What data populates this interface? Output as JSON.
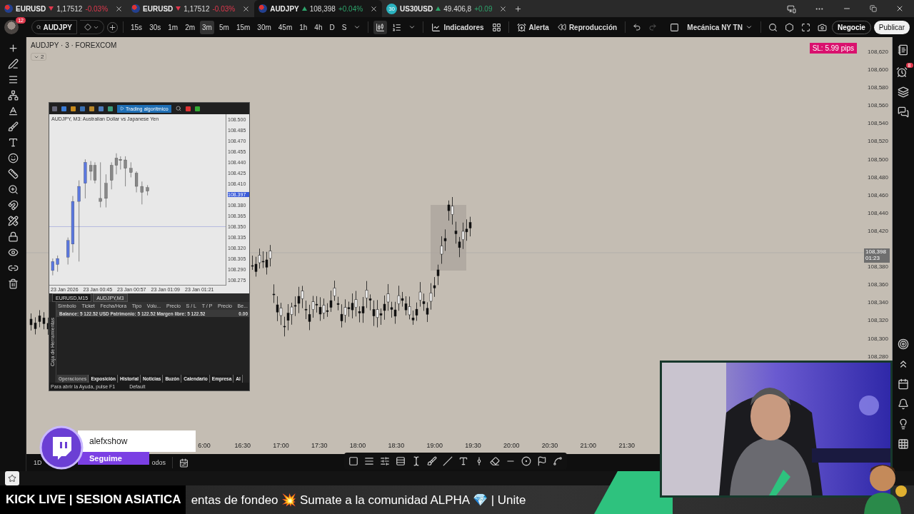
{
  "browser_tabs": [
    {
      "symbol": "EURUSD",
      "rising": false,
      "price": "1,17512",
      "change": "-0.03%",
      "selected": false
    },
    {
      "symbol": "EURUSD",
      "rising": false,
      "price": "1,17512",
      "change": "-0.03%",
      "selected": false
    },
    {
      "symbol": "AUDJPY",
      "rising": true,
      "price": "108,398",
      "change": "+0.04%",
      "selected": true
    },
    {
      "symbol": "US30USD",
      "rising": true,
      "price": "49.406,8",
      "change": "+0.09",
      "selected": false,
      "badge": "30"
    }
  ],
  "toolbar": {
    "avatar_badge": "12",
    "symbol": "AUDJPY",
    "intervals": [
      {
        "label": "15s",
        "selected": false
      },
      {
        "label": "30s",
        "selected": false
      },
      {
        "label": "1m",
        "selected": false
      },
      {
        "label": "2m",
        "selected": false
      },
      {
        "label": "3m",
        "selected": true
      },
      {
        "label": "5m",
        "selected": false
      },
      {
        "label": "15m",
        "selected": false
      },
      {
        "label": "30m",
        "selected": false
      },
      {
        "label": "45m",
        "selected": false
      },
      {
        "label": "1h",
        "selected": false
      },
      {
        "label": "4h",
        "selected": false
      },
      {
        "label": "D",
        "selected": false
      },
      {
        "label": "S",
        "selected": false
      }
    ],
    "indicators": "Indicadores",
    "alert": "Alerta",
    "replay": "Reproducción",
    "layout": "Mecánica NY TN",
    "trade": "Negocie",
    "publish": "Publicar"
  },
  "chart": {
    "title": "AUDJPY · 3 · FOREXCOM",
    "collapse_count": "2",
    "sl_badge": "SL: 5.99 pips",
    "price_scale": [
      "108,620",
      "108,600",
      "108,580",
      "108,560",
      "108,540",
      "108,520",
      "108,500",
      "108,480",
      "108,460",
      "108,440",
      "108,420",
      "108,380",
      "108,360",
      "108,340",
      "108,320",
      "108,300",
      "108,280"
    ],
    "last_price": "108,398",
    "countdown": "01:23",
    "time_scale": [
      "6:00",
      "16:30",
      "17:00",
      "17:30",
      "18:00",
      "18:30",
      "19:00",
      "19:30",
      "20:00",
      "20:30",
      "21:00",
      "21:30"
    ]
  },
  "mt5_window": {
    "toolbar_button": "Trading algorítmico",
    "chart_title": "AUDJPY, M3:  Australian Dollar vs Japanese Yen",
    "prices": [
      "108.500",
      "108.485",
      "108.470",
      "108.455",
      "108.440",
      "108.425",
      "108.410",
      "108.397",
      "108.380",
      "108.365",
      "108.350",
      "108.335",
      "108.320",
      "108.305",
      "108.290",
      "108.275"
    ],
    "dates": [
      "23 Jan 2026",
      "23 Jan 00:45",
      "23 Jan 00:57",
      "23 Jan 01:09",
      "23 Jan 01:21"
    ],
    "symbol_tabs": [
      {
        "label": "EURUSD,M15",
        "selected": false
      },
      {
        "label": "AUDJPY,M3",
        "selected": true
      }
    ],
    "columns": [
      "Símbolo",
      "Ticket",
      "Fecha/Hora",
      "Tipo",
      "Volu...",
      "Precio",
      "S / L",
      "T / P",
      "Precio",
      "Be..."
    ],
    "balance": "Balance: 5 122.52 USD  Patrimonio: 5 122.52  Margen libre: 5 122.52",
    "balance_value": "0.00",
    "side_label": "Caja de Herramientas",
    "bottom_tabs": [
      {
        "label": "Operaciones",
        "selected": true
      },
      {
        "label": "Exposición",
        "selected": false
      },
      {
        "label": "Historial",
        "selected": false
      },
      {
        "label": "Noticias",
        "selected": false
      },
      {
        "label": "Buzón",
        "selected": false
      },
      {
        "label": "Calendario",
        "selected": false
      },
      {
        "label": "Empresa",
        "selected": false
      },
      {
        "label": "Al",
        "selected": false
      }
    ],
    "status": "Para abrir la Ayuda, pulse F1",
    "profile": "Default"
  },
  "bottom_bar": {
    "range": "1D",
    "label": "odos"
  },
  "right_sidebar": {
    "alerts_badge": "8"
  },
  "overlay": {
    "channel": "alefxshow",
    "follow": "Seguime",
    "ticker_title": "KICK LIVE | SESION ASIATICA",
    "ticker_text": "entas de fondeo 💥 Sumate a la comunidad ALPHA 💎 | Unite"
  }
}
